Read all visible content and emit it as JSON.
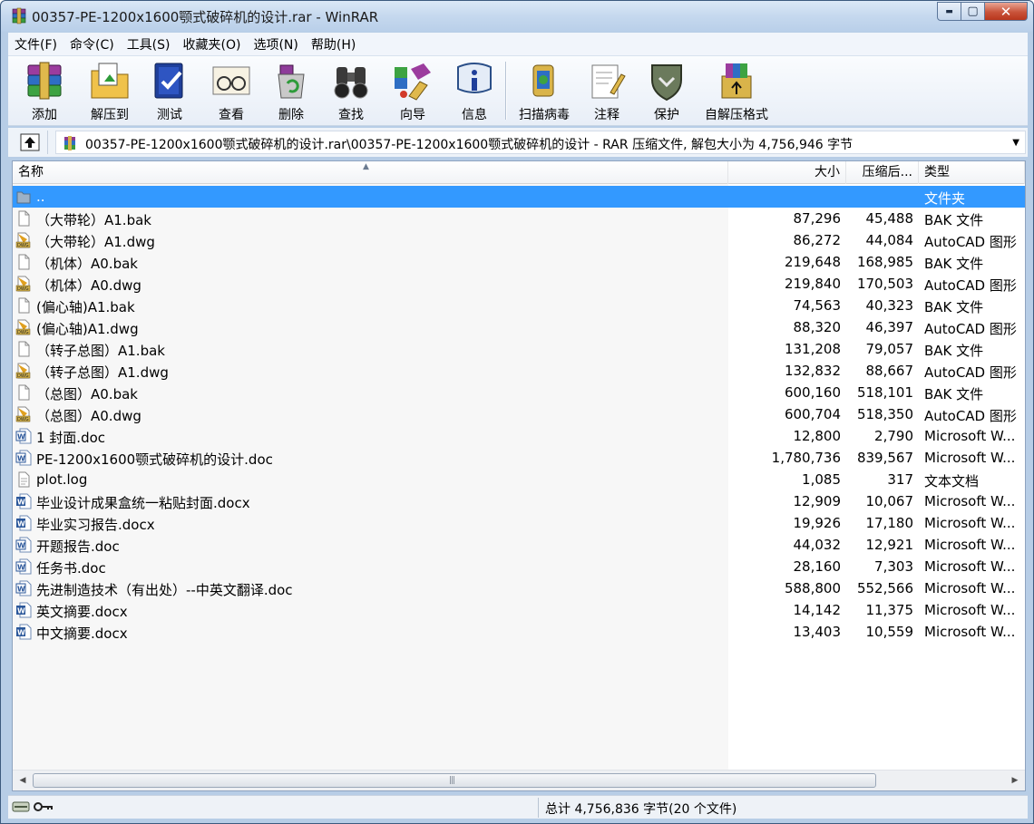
{
  "window": {
    "title": "00357-PE-1200x1600颚式破碎机的设计.rar - WinRAR",
    "minimize_label": "▬",
    "maximize_label": "▢",
    "close_label": "✕"
  },
  "menu": {
    "items": [
      {
        "label": "文件(F)"
      },
      {
        "label": "命令(C)"
      },
      {
        "label": "工具(S)"
      },
      {
        "label": "收藏夹(O)"
      },
      {
        "label": "选项(N)"
      },
      {
        "label": "帮助(H)"
      }
    ]
  },
  "toolbar": {
    "buttons": [
      {
        "label": "添加",
        "icon": "books-icon"
      },
      {
        "label": "解压到",
        "icon": "folder-extract-icon"
      },
      {
        "label": "测试",
        "icon": "checkbook-icon"
      },
      {
        "label": "查看",
        "icon": "glasses-icon"
      },
      {
        "label": "删除",
        "icon": "recycle-bin-icon"
      },
      {
        "label": "查找",
        "icon": "binoculars-icon"
      },
      {
        "label": "向导",
        "icon": "wizard-icon"
      },
      {
        "label": "信息",
        "icon": "info-icon"
      },
      {
        "label": "扫描病毒",
        "icon": "virus-scan-icon"
      },
      {
        "label": "注释",
        "icon": "comment-icon"
      },
      {
        "label": "保护",
        "icon": "shield-icon"
      },
      {
        "label": "自解压格式",
        "icon": "sfx-icon"
      }
    ]
  },
  "address": {
    "path": "00357-PE-1200x1600颚式破碎机的设计.rar\\00357-PE-1200x1600颚式破碎机的设计 - RAR 压缩文件, 解包大小为 4,756,946 字节"
  },
  "columns": {
    "name": "名称",
    "size": "大小",
    "packed": "压缩后...",
    "type": "类型"
  },
  "files": [
    {
      "name": "..",
      "size": "",
      "packed": "",
      "type": "文件夹",
      "icon": "folder-up-icon",
      "selected": true
    },
    {
      "name": "（大带轮）A1.bak",
      "size": "87,296",
      "packed": "45,488",
      "type": "BAK 文件",
      "icon": "blank-file-icon"
    },
    {
      "name": "（大带轮）A1.dwg",
      "size": "86,272",
      "packed": "44,084",
      "type": "AutoCAD 图形",
      "icon": "dwg-file-icon"
    },
    {
      "name": "（机体）A0.bak",
      "size": "219,648",
      "packed": "168,985",
      "type": "BAK 文件",
      "icon": "blank-file-icon"
    },
    {
      "name": "（机体）A0.dwg",
      "size": "219,840",
      "packed": "170,503",
      "type": "AutoCAD 图形",
      "icon": "dwg-file-icon"
    },
    {
      "name": "(偏心轴)A1.bak",
      "size": "74,563",
      "packed": "40,323",
      "type": "BAK 文件",
      "icon": "blank-file-icon"
    },
    {
      "name": "(偏心轴)A1.dwg",
      "size": "88,320",
      "packed": "46,397",
      "type": "AutoCAD 图形",
      "icon": "dwg-file-icon"
    },
    {
      "name": "（转子总图）A1.bak",
      "size": "131,208",
      "packed": "79,057",
      "type": "BAK 文件",
      "icon": "blank-file-icon"
    },
    {
      "name": "（转子总图）A1.dwg",
      "size": "132,832",
      "packed": "88,667",
      "type": "AutoCAD 图形",
      "icon": "dwg-file-icon"
    },
    {
      "name": "（总图）A0.bak",
      "size": "600,160",
      "packed": "518,101",
      "type": "BAK 文件",
      "icon": "blank-file-icon"
    },
    {
      "name": "（总图）A0.dwg",
      "size": "600,704",
      "packed": "518,350",
      "type": "AutoCAD 图形",
      "icon": "dwg-file-icon"
    },
    {
      "name": "1 封面.doc",
      "size": "12,800",
      "packed": "2,790",
      "type": "Microsoft W...",
      "icon": "word-doc-icon"
    },
    {
      "name": "PE-1200x1600颚式破碎机的设计.doc",
      "size": "1,780,736",
      "packed": "839,567",
      "type": "Microsoft W...",
      "icon": "word-doc-icon"
    },
    {
      "name": "plot.log",
      "size": "1,085",
      "packed": "317",
      "type": "文本文档",
      "icon": "text-file-icon"
    },
    {
      "name": "毕业设计成果盒统一粘贴封面.docx",
      "size": "12,909",
      "packed": "10,067",
      "type": "Microsoft W...",
      "icon": "word-docx-icon"
    },
    {
      "name": "毕业实习报告.docx",
      "size": "19,926",
      "packed": "17,180",
      "type": "Microsoft W...",
      "icon": "word-docx-icon"
    },
    {
      "name": "开题报告.doc",
      "size": "44,032",
      "packed": "12,921",
      "type": "Microsoft W...",
      "icon": "word-doc-icon"
    },
    {
      "name": "任务书.doc",
      "size": "28,160",
      "packed": "7,303",
      "type": "Microsoft W...",
      "icon": "word-doc-icon"
    },
    {
      "name": "先进制造技术（有出处）--中英文翻译.doc",
      "size": "588,800",
      "packed": "552,566",
      "type": "Microsoft W...",
      "icon": "word-doc-icon"
    },
    {
      "name": "英文摘要.docx",
      "size": "14,142",
      "packed": "11,375",
      "type": "Microsoft W...",
      "icon": "word-docx-icon"
    },
    {
      "name": "中文摘要.docx",
      "size": "13,403",
      "packed": "10,559",
      "type": "Microsoft W...",
      "icon": "word-docx-icon"
    }
  ],
  "status": {
    "text": "总计 4,756,836 字节(20 个文件)"
  },
  "colors": {
    "selection": "#3399ff",
    "frame": "#b7cde6"
  }
}
